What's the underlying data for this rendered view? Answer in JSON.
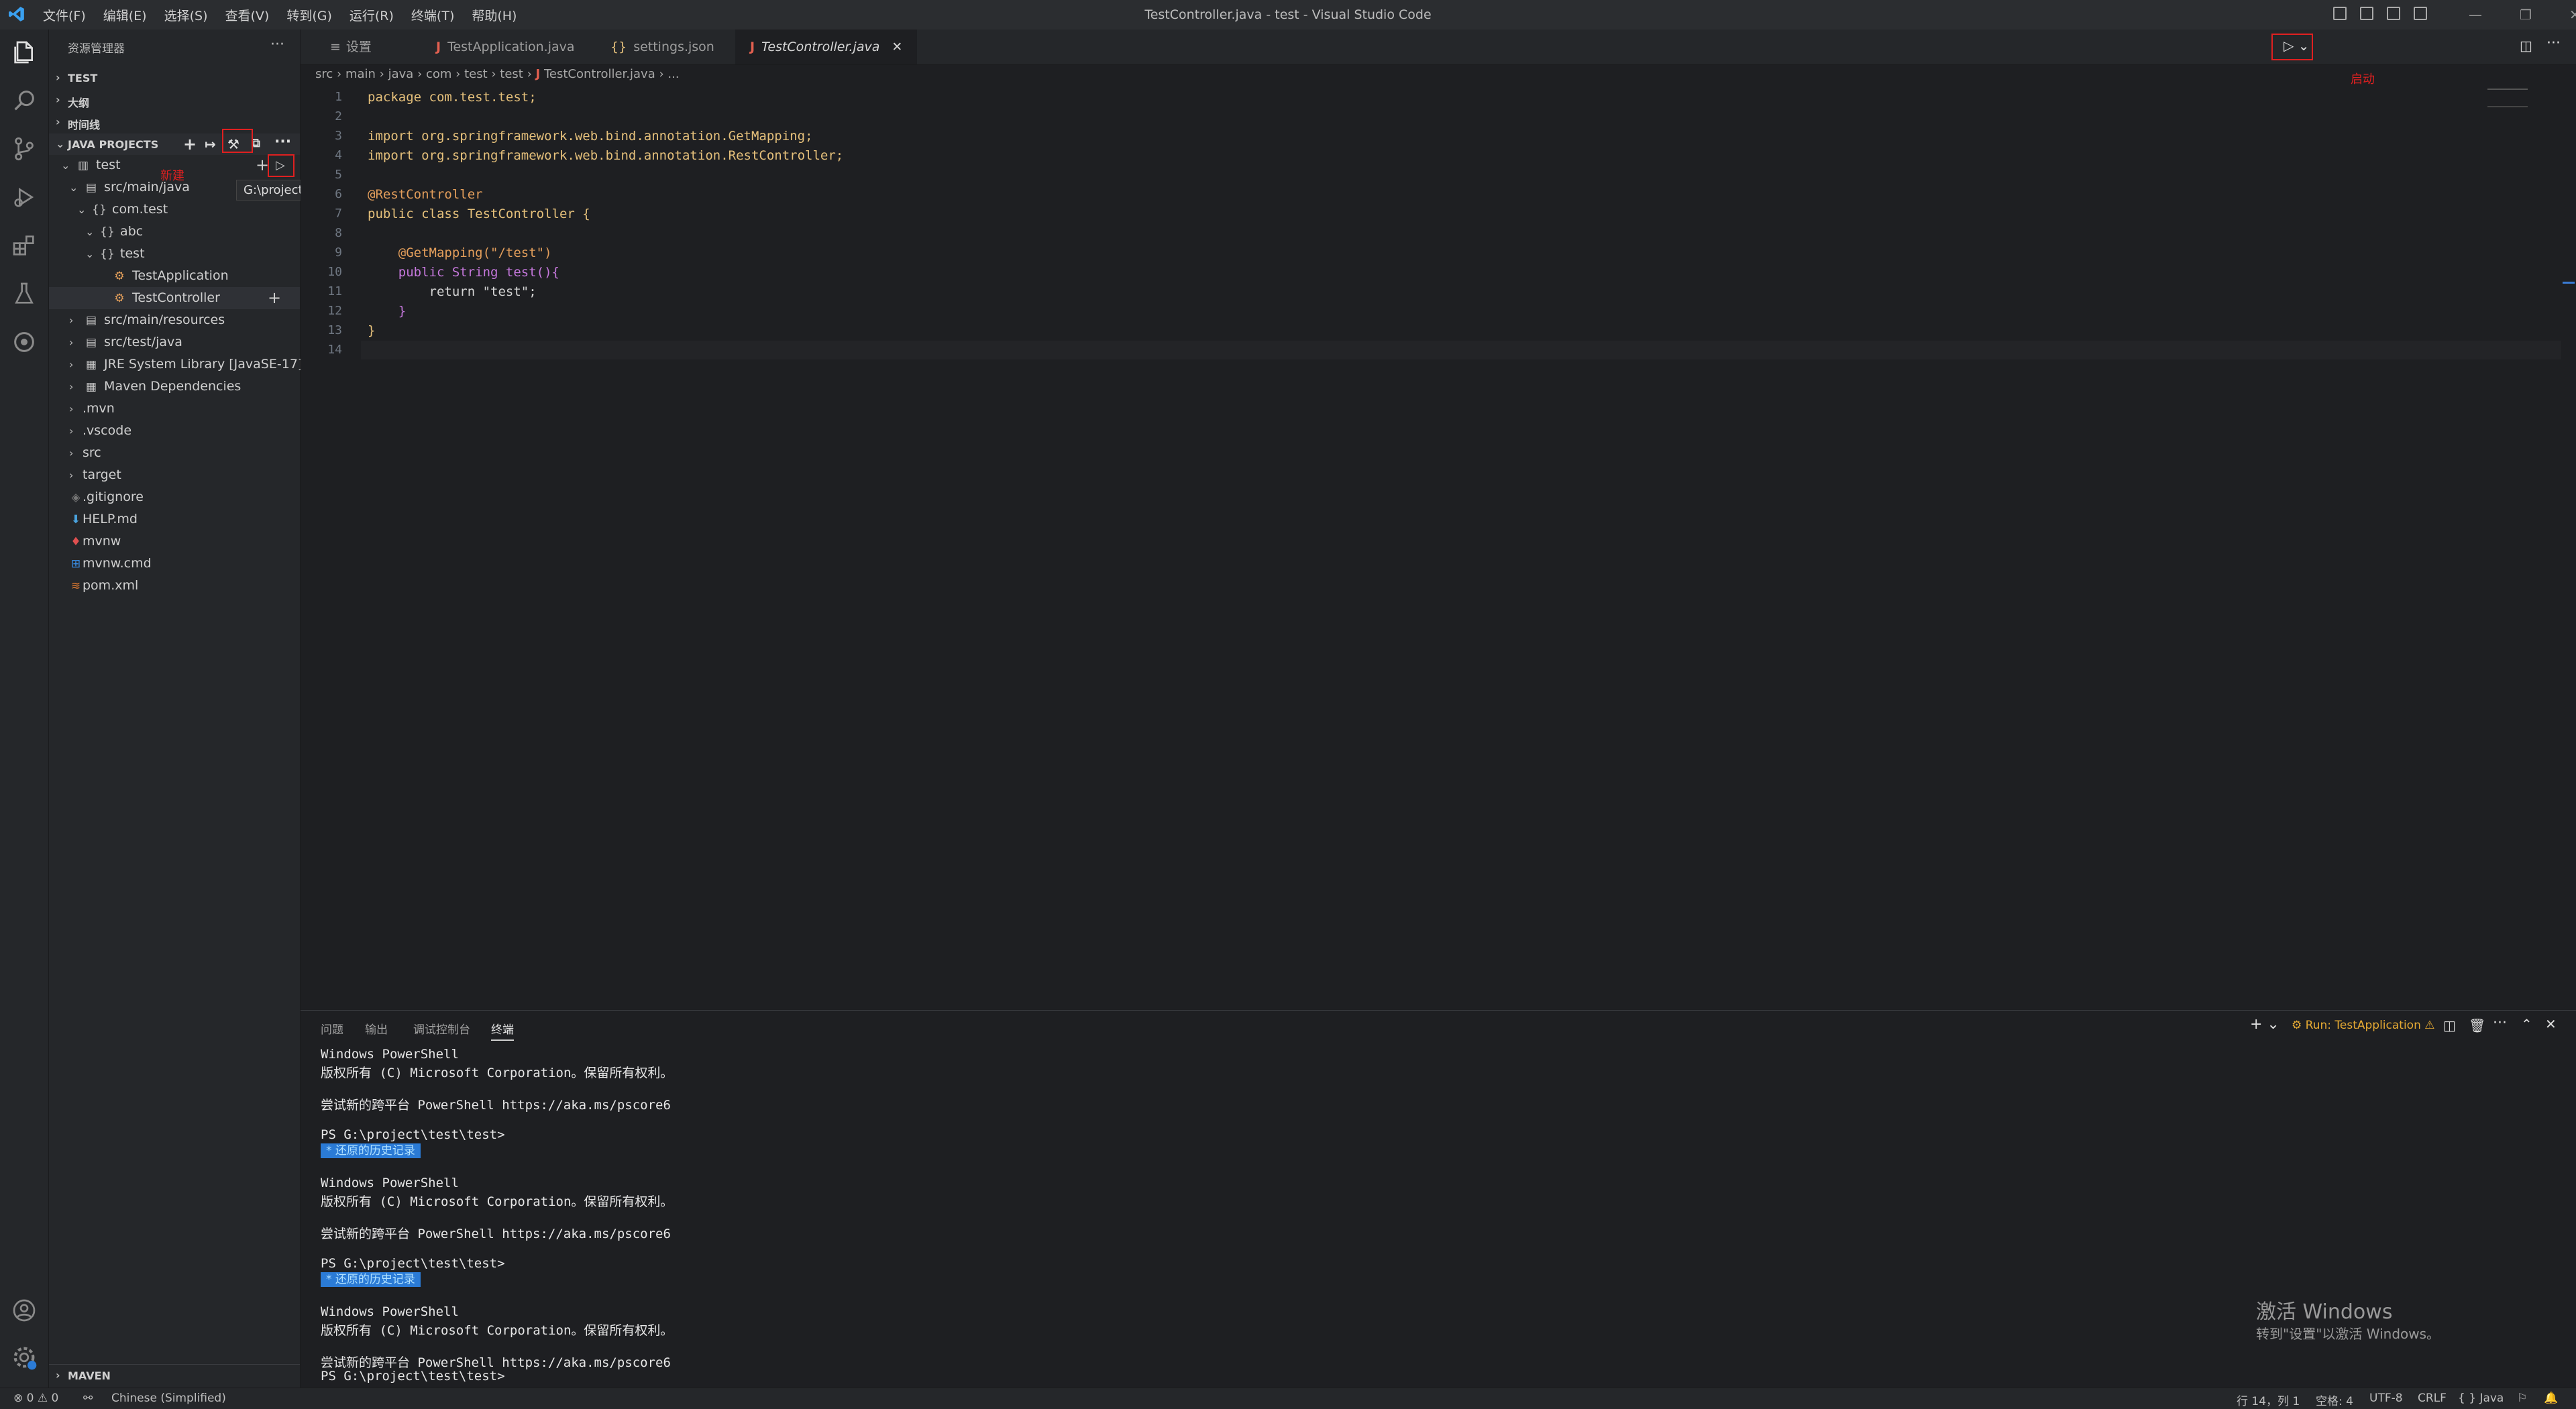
{
  "window": {
    "title": "TestController.java - test - Visual Studio Code",
    "menu": [
      "文件(F)",
      "编辑(E)",
      "选择(S)",
      "查看(V)",
      "转到(G)",
      "运行(R)",
      "终端(T)",
      "帮助(H)"
    ]
  },
  "sidebar": {
    "title": "资源管理器",
    "sections": {
      "test": "TEST",
      "outline": "大纲",
      "timeline": "时间线",
      "java_projects": "JAVA PROJECTS",
      "maven": "MAVEN"
    },
    "tree": [
      "test",
      "src/main/java",
      "com.test",
      "abc",
      "test",
      "TestApplication",
      "TestController",
      "src/main/resources",
      "src/test/java",
      "JRE System Library [JavaSE-17]",
      "Maven Dependencies",
      ".mvn",
      ".vscode",
      "src",
      "target",
      ".gitignore",
      "HELP.md",
      "mvnw",
      "mvnw.cmd",
      "pom.xml"
    ],
    "tooltip": "G:\\project\\test\\test\\",
    "annotations": {
      "new": "新建",
      "run": "启动"
    }
  },
  "tabs": [
    {
      "label": "设置",
      "icon": "settings-icon"
    },
    {
      "label": "TestApplication.java",
      "icon": "java-icon"
    },
    {
      "label": "settings.json",
      "icon": "json-icon"
    },
    {
      "label": "TestController.java",
      "icon": "java-icon",
      "active": true
    }
  ],
  "breadcrumb": [
    "src",
    "main",
    "java",
    "com",
    "test",
    "test",
    "TestController.java",
    "..."
  ],
  "editor_annotation": "启动",
  "code_lines": [
    "package com.test.test;",
    "",
    "import org.springframework.web.bind.annotation.GetMapping;",
    "import org.springframework.web.bind.annotation.RestController;",
    "",
    "@RestController",
    "public class TestController {",
    "",
    "    @GetMapping(\"/test\")",
    "    public String test(){",
    "        return \"test\";",
    "    }",
    "}",
    ""
  ],
  "panel": {
    "tabs": [
      "问题",
      "输出",
      "调试控制台",
      "终端"
    ],
    "run_label": "Run: TestApplication",
    "terminal": {
      "l1": "Windows PowerShell",
      "l2": "版权所有 (C) Microsoft Corporation。保留所有权利。",
      "l3": "尝试新的跨平台 PowerShell https://aka.ms/pscore6",
      "prompt": "PS G:\\project\\test\\test>",
      "history": "*  还原的历史记录"
    }
  },
  "watermark": {
    "line1": "激活 Windows",
    "line2": "转到\"设置\"以激活 Windows。"
  },
  "status": {
    "problems": "⊗ 0 ⚠ 0",
    "language_pack": "Chinese (Simplified)",
    "cursor": "行 14，列 1",
    "spaces": "空格: 4",
    "encoding": "UTF-8",
    "eol": "CRLF",
    "language": "{ } Java"
  },
  "colors": {
    "accent": "#2b7bd6",
    "annotation_red": "#e02020",
    "java_icon": "#e36050"
  }
}
